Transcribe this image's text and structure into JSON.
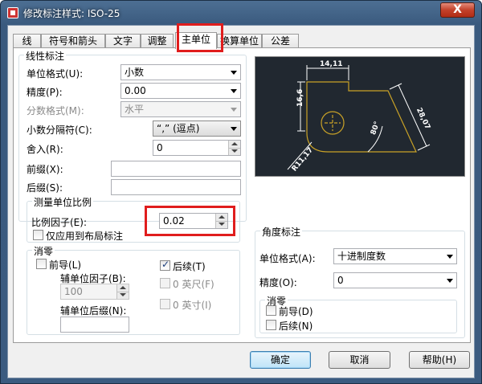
{
  "window": {
    "title": "修改标注样式: ISO-25",
    "close_symbol": "X"
  },
  "tabs": [
    {
      "label": "线"
    },
    {
      "label": "符号和箭头"
    },
    {
      "label": "文字"
    },
    {
      "label": "调整"
    },
    {
      "label": "主单位"
    },
    {
      "label": "换算单位"
    },
    {
      "label": "公差"
    }
  ],
  "linear": {
    "group_title": "线性标注",
    "unit_format_label": "单位格式(U):",
    "unit_format_value": "小数",
    "precision_label": "精度(P):",
    "precision_value": "0.00",
    "fraction_format_label": "分数格式(M):",
    "fraction_format_value": "水平",
    "decimal_separator_label": "小数分隔符(C):",
    "decimal_separator_value": "“,” (逗点)",
    "round_off_label": "舍入(R):",
    "round_off_value": "0",
    "prefix_label": "前缀(X):",
    "prefix_value": "",
    "suffix_label": "后缀(S):",
    "suffix_value": ""
  },
  "measurement_scale": {
    "group_title": "测量单位比例",
    "scale_factor_label": "比例因子(E):",
    "scale_factor_value": "0.02",
    "layout_only_label": "仅应用到布局标注"
  },
  "zero_suppression": {
    "group_title": "消零",
    "leading_label": "前导(L)",
    "sub_unit_factor_label": "辅单位因子(B):",
    "sub_unit_factor_value": "100",
    "sub_unit_suffix_label": "辅单位后缀(N):",
    "sub_unit_suffix_value": "",
    "trailing_label": "后续(T)",
    "zero_feet_label": "0 英尺(F)",
    "zero_inches_label": "0 英寸(I)"
  },
  "angular": {
    "group_title": "角度标注",
    "unit_format_label": "单位格式(A):",
    "unit_format_value": "十进制度数",
    "precision_label": "精度(O):",
    "precision_value": "0",
    "zero_group_title": "消零",
    "leading_label": "前导(D)",
    "trailing_label": "后续(N)"
  },
  "preview": {
    "dim_top": "14,11",
    "dim_left": "16,6",
    "dim_right": "28,07",
    "dim_angle": "80°",
    "dim_radius": "R11,17",
    "colors": {
      "background": "#212830",
      "geometry": "#c9a227",
      "dimension": "#ffffff"
    }
  },
  "buttons": {
    "ok": "确定",
    "cancel": "取消",
    "help": "帮助(H)"
  },
  "highlight_color": "#e01d1d"
}
